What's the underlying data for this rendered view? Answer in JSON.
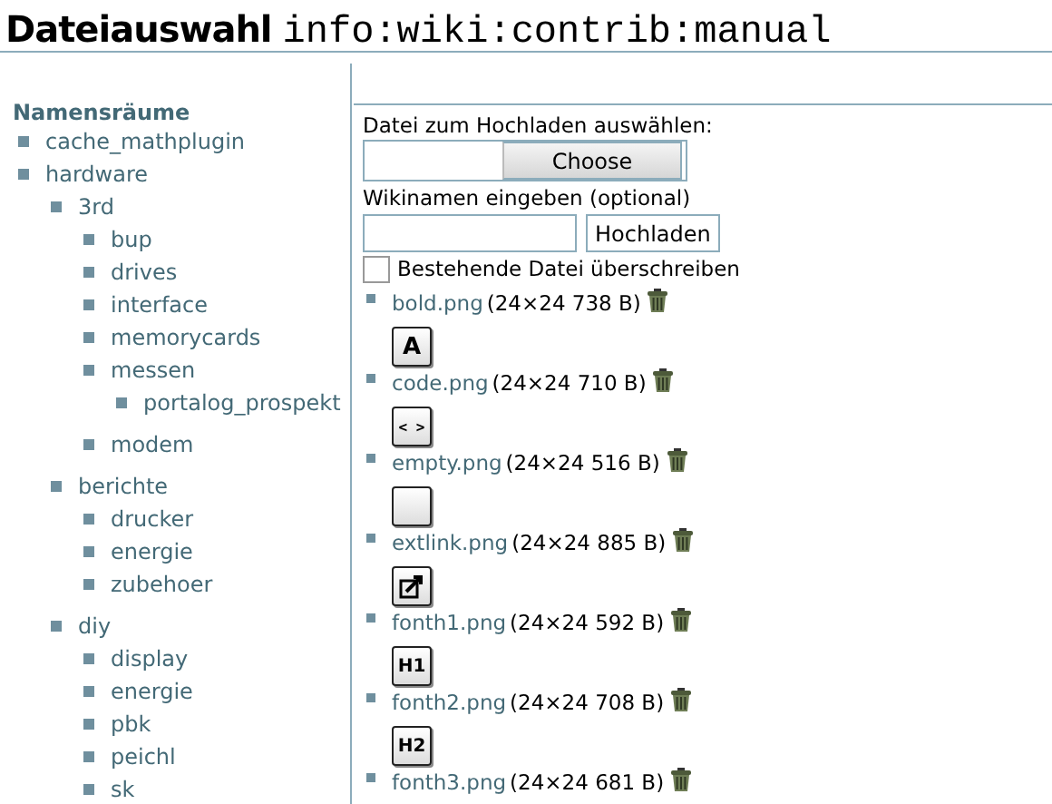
{
  "header": {
    "title": "Dateiauswahl",
    "namespace": "info:wiki:contrib:manual"
  },
  "sidebar": {
    "heading": "Namensräume",
    "items": [
      {
        "label": "cache_mathplugin"
      },
      {
        "label": "hardware",
        "children": [
          {
            "label": "3rd",
            "children": [
              {
                "label": "bup"
              },
              {
                "label": "drives"
              },
              {
                "label": "interface"
              },
              {
                "label": "memorycards"
              },
              {
                "label": "messen",
                "children": [
                  {
                    "label": "portalog_prospekt"
                  }
                ]
              },
              {
                "label": "modem"
              }
            ]
          },
          {
            "label": "berichte",
            "children": [
              {
                "label": "drucker"
              },
              {
                "label": "energie"
              },
              {
                "label": "zubehoer"
              }
            ]
          },
          {
            "label": "diy",
            "children": [
              {
                "label": "display"
              },
              {
                "label": "energie"
              },
              {
                "label": "pbk"
              },
              {
                "label": "peichl"
              },
              {
                "label": "sk"
              }
            ]
          }
        ]
      }
    ]
  },
  "upload": {
    "file_label": "Datei zum Hochladen auswählen:",
    "choose_button": "Choose",
    "name_label": "Wikinamen eingeben (optional)",
    "upload_button": "Hochladen",
    "overwrite": {
      "label": "Bestehende Datei überschreiben",
      "checked": false
    }
  },
  "files": [
    {
      "name": "bold.png",
      "info": "(24×24 738 B)",
      "preview": {
        "kind": "letter",
        "text": "A"
      }
    },
    {
      "name": "code.png",
      "info": "(24×24 710 B)",
      "preview": {
        "kind": "code",
        "text": "< >"
      }
    },
    {
      "name": "empty.png",
      "info": "(24×24 516 B)",
      "preview": {
        "kind": "blank"
      }
    },
    {
      "name": "extlink.png",
      "info": "(24×24 885 B)",
      "preview": {
        "kind": "arrow"
      }
    },
    {
      "name": "fonth1.png",
      "info": "(24×24 592 B)",
      "preview": {
        "kind": "letter",
        "text": "H1"
      }
    },
    {
      "name": "fonth2.png",
      "info": "(24×24 708 B)",
      "preview": {
        "kind": "letter",
        "text": "H2"
      }
    },
    {
      "name": "fonth3.png",
      "info": "(24×24 681 B)"
    }
  ]
}
